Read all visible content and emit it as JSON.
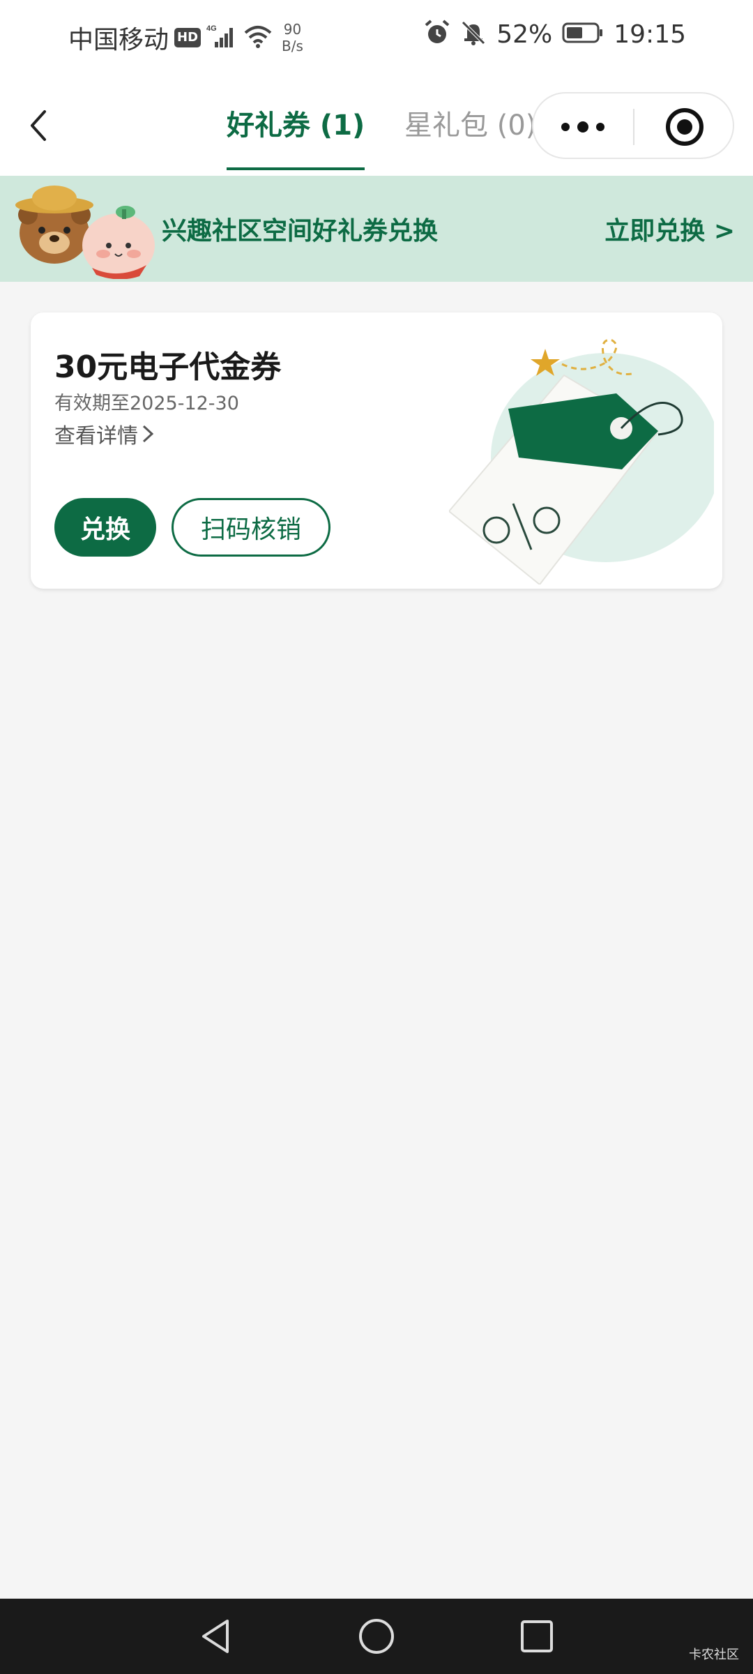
{
  "status_bar": {
    "carrier": "中国移动",
    "hd_badge": "HD",
    "network_type": "4G",
    "net_speed_value": "90",
    "net_speed_unit": "B/s",
    "battery_percent": "52%",
    "time": "19:15"
  },
  "nav": {
    "tabs": [
      {
        "label": "好礼券 (1)",
        "active": true
      },
      {
        "label": "星礼包 (0)",
        "active": false
      }
    ]
  },
  "banner": {
    "text": "兴趣社区空间好礼券兑换",
    "action": "立即兑换 >"
  },
  "coupon": {
    "title": "30元电子代金券",
    "expiry": "有效期至2025-12-30",
    "details_link": "查看详情",
    "redeem_label": "兑换",
    "scan_label": "扫码核销"
  },
  "watermark": "卡农社区",
  "colors": {
    "brand_green": "#0d6b44",
    "banner_bg": "#cfe8dc",
    "page_bg": "#f5f5f5"
  },
  "icons": [
    "signal-icon",
    "wifi-icon",
    "alarm-icon",
    "mute-icon",
    "battery-icon",
    "back-icon",
    "more-icon",
    "close-target-icon",
    "chevron-right-icon",
    "system-back-icon",
    "system-home-icon",
    "system-recents-icon"
  ]
}
